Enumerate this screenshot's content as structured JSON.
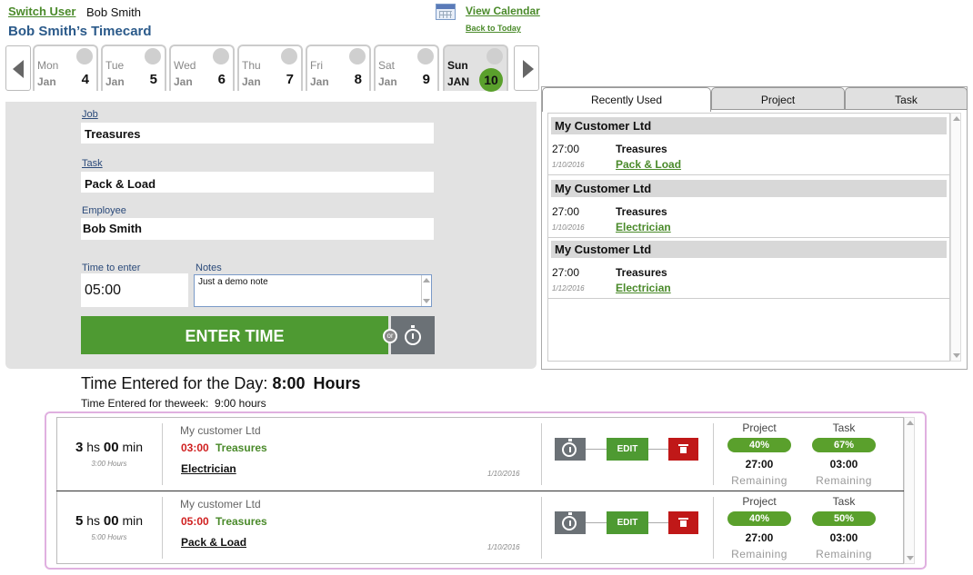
{
  "header": {
    "switch_user": "Switch User",
    "user_name": "Bob Smith",
    "title": "Bob Smith’s Timecard",
    "view_calendar": "View Calendar",
    "back_to_today": "Back to Today"
  },
  "days": [
    {
      "name": "Mon",
      "month": "Jan",
      "num": "4"
    },
    {
      "name": "Tue",
      "month": "Jan",
      "num": "5"
    },
    {
      "name": "Wed",
      "month": "Jan",
      "num": "6"
    },
    {
      "name": "Thu",
      "month": "Jan",
      "num": "7"
    },
    {
      "name": "Fri",
      "month": "Jan",
      "num": "8"
    },
    {
      "name": "Sat",
      "month": "Jan",
      "num": "9"
    },
    {
      "name": "Sun",
      "month": "JAN",
      "num": "10",
      "active": true
    }
  ],
  "form": {
    "job_label": "Job",
    "job_value": "Treasures",
    "task_label": "Task",
    "task_value": "Pack & Load",
    "employee_label": "Employee",
    "employee_value": "Bob Smith",
    "time_label": "Time to enter",
    "time_value": "05:00",
    "notes_label": "Notes",
    "notes_value": "Just a demo note",
    "enter_button": "ENTER TIME",
    "or": "or"
  },
  "totals": {
    "day_prefix": "Time Entered for the Day:",
    "day_value": "8:00",
    "day_unit": "Hours",
    "week_text": "Time Entered for theweek:  9:00 hours"
  },
  "side_tabs": [
    "Recently Used",
    "Project",
    "Task"
  ],
  "recent": [
    {
      "customer": "My Customer Ltd",
      "time": "27:00",
      "date": "1/10/2016",
      "project": "Treasures",
      "task": "Pack & Load"
    },
    {
      "customer": "My Customer Ltd",
      "time": "27:00",
      "date": "1/10/2016",
      "project": "Treasures",
      "task": "Electrician"
    },
    {
      "customer": "My Customer Ltd",
      "time": "27:00",
      "date": "1/12/2016",
      "project": "Treasures",
      "task": "Electrician"
    }
  ],
  "entries": [
    {
      "hours": "3",
      "hs": "hs",
      "mins": "00",
      "min": "min",
      "sub": "3:00 Hours",
      "customer": "My customer Ltd",
      "time": "03:00",
      "project": "Treasures",
      "task": "Electrician",
      "date": "1/10/2016",
      "edit": "EDIT",
      "project_label": "Project",
      "project_pct": "40%",
      "project_rem": "27:00",
      "task_label": "Task",
      "task_pct": "67%",
      "task_rem": "03:00",
      "remaining": "Remaining"
    },
    {
      "hours": "5",
      "hs": "hs",
      "mins": "00",
      "min": "min",
      "sub": "5:00 Hours",
      "customer": "My customer Ltd",
      "time": "05:00",
      "project": "Treasures",
      "task": "Pack & Load",
      "date": "1/10/2016",
      "edit": "EDIT",
      "project_label": "Project",
      "project_pct": "40%",
      "project_rem": "27:00",
      "task_label": "Task",
      "task_pct": "50%",
      "task_rem": "03:00",
      "remaining": "Remaining"
    }
  ],
  "colors": {
    "accent_green": "#4e9a32",
    "link_blue": "#2b5a8a",
    "delete_red": "#c01818"
  }
}
